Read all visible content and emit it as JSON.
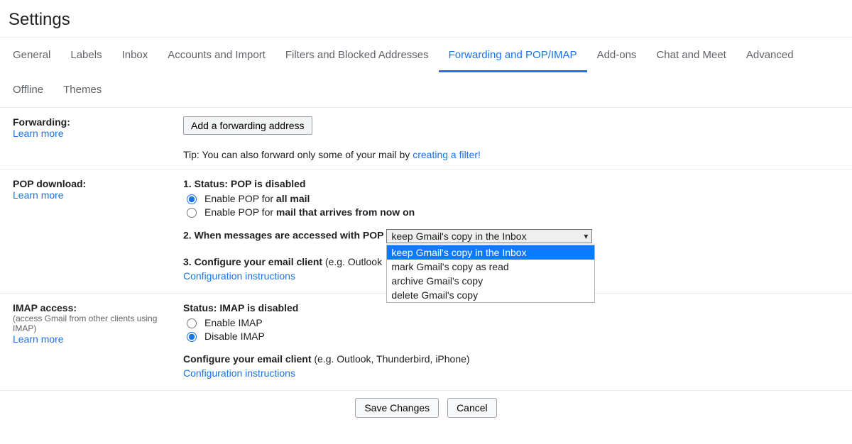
{
  "title": "Settings",
  "tabs": [
    "General",
    "Labels",
    "Inbox",
    "Accounts and Import",
    "Filters and Blocked Addresses",
    "Forwarding and POP/IMAP",
    "Add-ons",
    "Chat and Meet",
    "Advanced",
    "Offline",
    "Themes"
  ],
  "active_tab_index": 5,
  "forwarding": {
    "label": "Forwarding:",
    "learn_more": "Learn more",
    "button": "Add a forwarding address",
    "tip_prefix": "Tip: You can also forward only some of your mail by ",
    "tip_link": "creating a filter!"
  },
  "pop": {
    "label": "POP download:",
    "learn_more": "Learn more",
    "status_prefix": "1. Status: ",
    "status_value": "POP is disabled",
    "radio1_prefix": "Enable POP for ",
    "radio1_bold": "all mail",
    "radio2_prefix": "Enable POP for ",
    "radio2_bold": "mail that arrives from now on",
    "when_label": "2. When messages are accessed with POP",
    "select_value": "keep Gmail's copy in the Inbox",
    "select_options": [
      "keep Gmail's copy in the Inbox",
      "mark Gmail's copy as read",
      "archive Gmail's copy",
      "delete Gmail's copy"
    ],
    "configure_bold": "3. Configure your email client",
    "configure_rest": " (e.g. Outlook",
    "config_link": "Configuration instructions"
  },
  "imap": {
    "label": "IMAP access:",
    "sub": "(access Gmail from other clients using IMAP)",
    "learn_more": "Learn more",
    "status_prefix": "Status: ",
    "status_value": "IMAP is disabled",
    "radio_enable": "Enable IMAP",
    "radio_disable": "Disable IMAP",
    "configure_bold": "Configure your email client",
    "configure_rest": " (e.g. Outlook, Thunderbird, iPhone)",
    "config_link": "Configuration instructions"
  },
  "footer": {
    "save": "Save Changes",
    "cancel": "Cancel"
  }
}
